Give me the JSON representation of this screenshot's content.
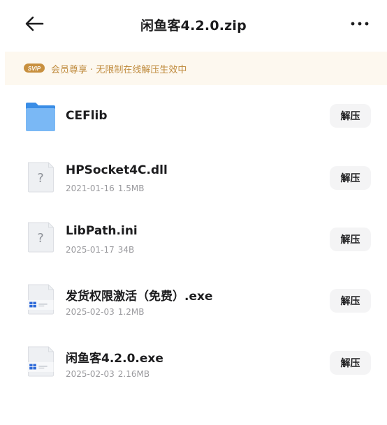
{
  "header": {
    "title": "闲鱼客4.2.0.zip",
    "back_icon": "arrow-left-icon",
    "more_icon": "more-horizontal-icon"
  },
  "banner": {
    "badge": "SVIP",
    "text": "会员尊享 · 无限制在线解压生效中",
    "color": "#bf8a3c",
    "background": "#fdf8ef"
  },
  "files": [
    {
      "name": "CEFlib",
      "date": "",
      "size": "",
      "icon": "folder-icon",
      "action": "解压"
    },
    {
      "name": "HPSocket4C.dll",
      "date": "2021-01-16",
      "size": "1.5MB",
      "icon": "unknown-file-icon",
      "action": "解压"
    },
    {
      "name": "LibPath.ini",
      "date": "2025-01-17",
      "size": "34B",
      "icon": "unknown-file-icon",
      "action": "解压"
    },
    {
      "name": "发货权限激活（免费）.exe",
      "date": "2025-02-03",
      "size": "1.2MB",
      "icon": "exe-file-icon",
      "action": "解压"
    },
    {
      "name": "闲鱼客4.2.0.exe",
      "date": "2025-02-03",
      "size": "2.16MB",
      "icon": "exe-file-icon",
      "action": "解压"
    }
  ]
}
